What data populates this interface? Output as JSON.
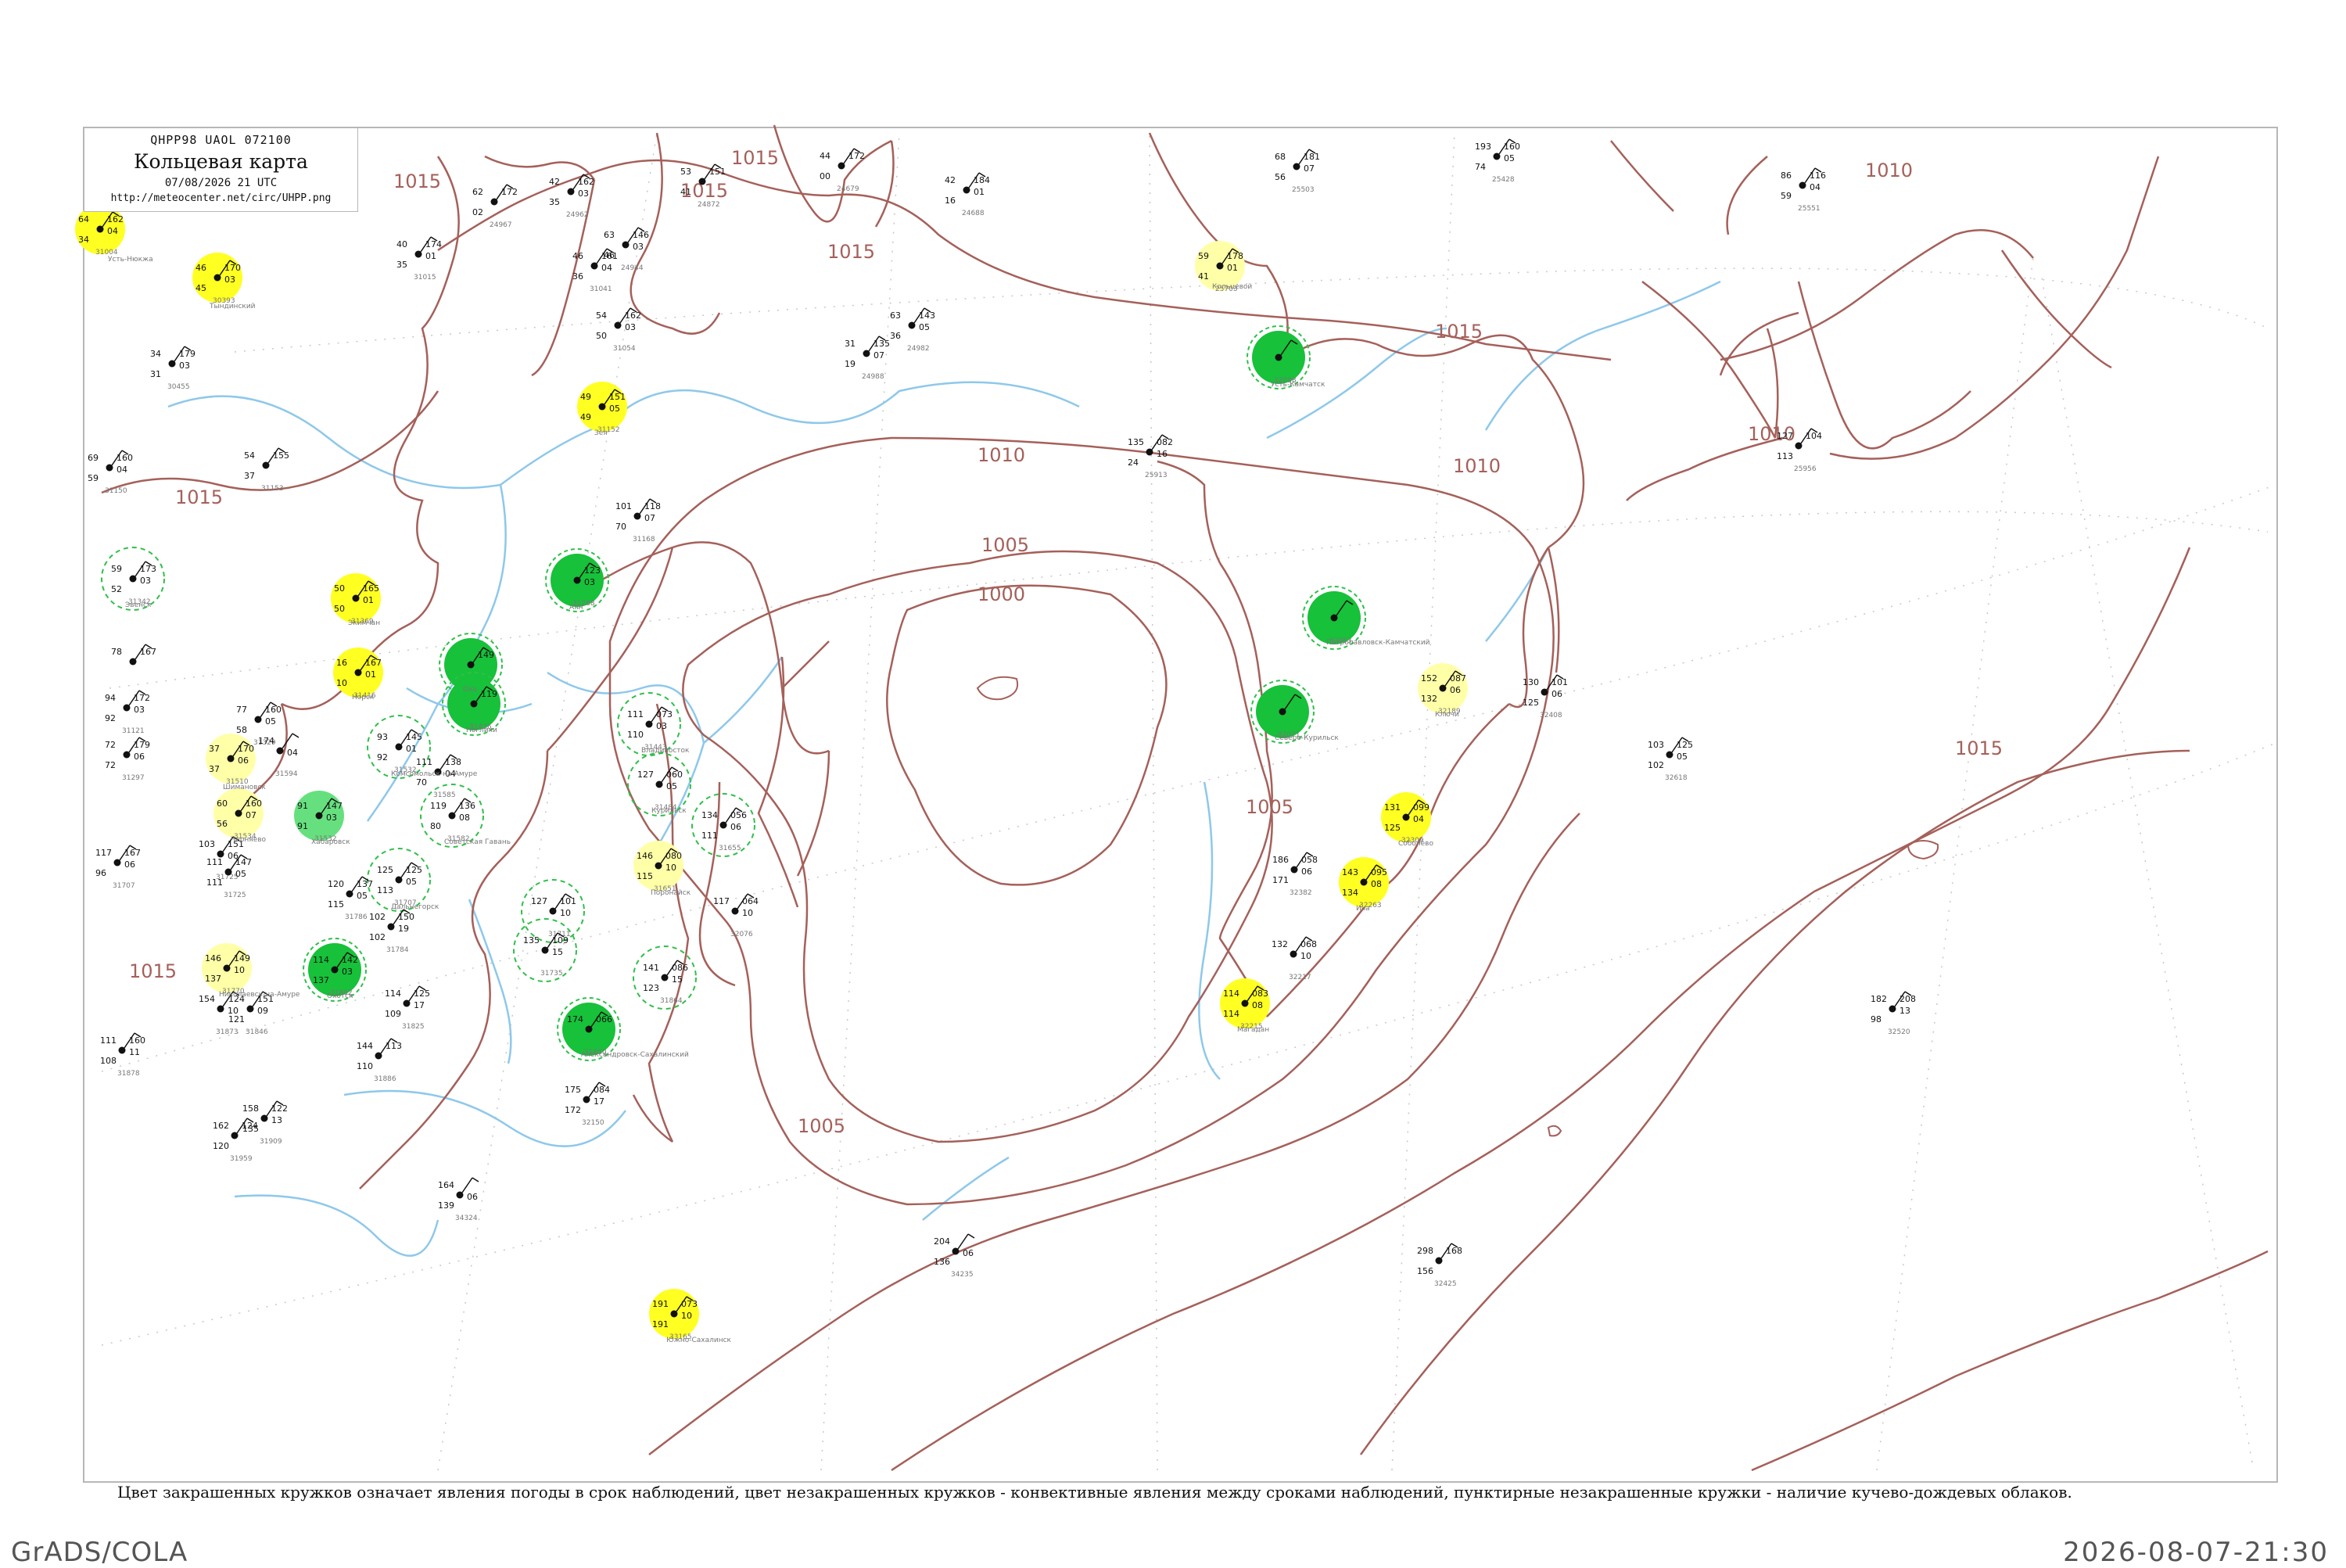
{
  "header": {
    "code_line": "QHPP98 UAOL 072100",
    "title": "Кольцевая карта",
    "date_line": "07/08/2026 21 UTC",
    "url": "http://meteocenter.net/circ/UHPP.png"
  },
  "caption": "Цвет закрашенных кружков означает явления погоды в срок наблюдений, цвет незакрашенных кружков - конвективные явления между сроками наблюдений, пунктирные незакрашенные кружки - наличие кучево-дождевых облаков.",
  "footer": {
    "left": "GrADS/COLA",
    "right": "2026-08-07-21:30"
  },
  "colors": {
    "coast": "#a5605a",
    "river": "#8ec8ea",
    "isobar": "#a5605a",
    "yellow": "#ffff22",
    "pale_yellow": "#ffffa8",
    "green": "#17c13a",
    "light_green": "#66e07e",
    "dashed_green": "#2fbf4a"
  },
  "isobar_labels": [
    {
      "text": "1015"
    },
    {
      "text": "1015"
    },
    {
      "text": "1015"
    },
    {
      "text": "1015"
    },
    {
      "text": "1015"
    },
    {
      "text": "1015"
    },
    {
      "text": "1015"
    },
    {
      "text": "1010"
    },
    {
      "text": "1010"
    },
    {
      "text": "1010"
    },
    {
      "text": "1010"
    },
    {
      "text": "1005"
    },
    {
      "text": "1005"
    },
    {
      "text": "1005"
    },
    {
      "text": "1000"
    },
    {
      "text": "1015"
    }
  ],
  "stations": [
    {
      "kind": "yellow",
      "t": "64",
      "td": "34",
      "p": "162",
      "dp": "04",
      "id": "31004"
    },
    {
      "kind": "yellow",
      "t": "46",
      "td": "45",
      "p": "170",
      "dp": "03",
      "id": "30393"
    },
    {
      "kind": "yellow",
      "t": "49",
      "td": "49",
      "p": "151",
      "dp": "05",
      "id": "31152"
    },
    {
      "kind": "pale_yellow",
      "t": "59",
      "td": "41",
      "p": "178",
      "dp": "01",
      "id": "25703"
    },
    {
      "kind": "yellow",
      "t": "50",
      "td": "50",
      "p": "165",
      "dp": "01",
      "id": "31369"
    },
    {
      "kind": "yellow",
      "t": "16",
      "td": "10",
      "p": "167",
      "dp": "01",
      "id": "31416"
    },
    {
      "kind": "pale_yellow",
      "t": "37",
      "td": "37",
      "p": "170",
      "dp": "06",
      "id": "31510"
    },
    {
      "kind": "pale_yellow",
      "t": "60",
      "td": "56",
      "p": "160",
      "dp": "07",
      "id": "31534"
    },
    {
      "kind": "light_green",
      "t": "91",
      "td": "91",
      "p": "147",
      "dp": "03",
      "id": "31532"
    },
    {
      "kind": "pale_yellow",
      "t": "146",
      "td": "137",
      "p": "149",
      "dp": "10",
      "id": "31770"
    },
    {
      "kind": "green",
      "t": "114",
      "td": "137",
      "p": "142",
      "dp": "03",
      "id": "31802"
    },
    {
      "kind": "green",
      "t": "",
      "td": "",
      "p": "123",
      "dp": "03",
      "id": "31288"
    },
    {
      "kind": "green",
      "t": "",
      "td": "",
      "p": "149",
      "dp": "",
      "id": "31418"
    },
    {
      "kind": "green",
      "t": "",
      "td": "",
      "p": "119",
      "dp": "",
      "id": "31436"
    },
    {
      "kind": "green",
      "t": "174",
      "td": "",
      "p": "066",
      "dp": "",
      "id": "31850"
    },
    {
      "kind": "pale_yellow",
      "t": "146",
      "td": "115",
      "p": "080",
      "dp": "10",
      "id": "31651"
    },
    {
      "kind": "yellow",
      "t": "191",
      "td": "191",
      "p": "073",
      "dp": "10",
      "id": "33165"
    },
    {
      "kind": "green",
      "t": "",
      "td": "",
      "p": "",
      "dp": "",
      "id": "32053"
    },
    {
      "kind": "green",
      "t": "",
      "td": "",
      "p": "",
      "dp": "",
      "id": "32071"
    },
    {
      "kind": "green",
      "t": "",
      "td": "",
      "p": "",
      "dp": "",
      "id": "32098"
    },
    {
      "kind": "pale_yellow",
      "t": "152",
      "td": "132",
      "p": "087",
      "dp": "06",
      "id": "32189"
    },
    {
      "kind": "yellow",
      "t": "131",
      "td": "125",
      "p": "099",
      "dp": "04",
      "id": "32309"
    },
    {
      "kind": "yellow",
      "t": "143",
      "td": "134",
      "p": "095",
      "dp": "08",
      "id": "32263"
    },
    {
      "kind": "yellow",
      "t": "114",
      "td": "114",
      "p": "083",
      "dp": "08",
      "id": "32215"
    },
    {
      "kind": "dashed",
      "t": "59",
      "td": "52",
      "p": "173",
      "dp": "03",
      "id": "31342"
    },
    {
      "kind": "dashed",
      "t": "93",
      "td": "92",
      "p": "145",
      "dp": "01",
      "id": "31532"
    },
    {
      "kind": "dashed",
      "t": "119",
      "td": "80",
      "p": "136",
      "dp": "08",
      "id": "31582"
    },
    {
      "kind": "dashed",
      "t": "125",
      "td": "113",
      "p": "125",
      "dp": "05",
      "id": "31707"
    },
    {
      "kind": "dashed",
      "t": "111",
      "td": "110",
      "p": "073",
      "dp": "03",
      "id": "31443"
    },
    {
      "kind": "dashed",
      "t": "127",
      "td": "",
      "p": "060",
      "dp": "05",
      "id": "31484"
    },
    {
      "kind": "dashed",
      "t": "134",
      "td": "111",
      "p": "056",
      "dp": "06",
      "id": "31655"
    },
    {
      "kind": "dashed",
      "t": "127",
      "td": "",
      "p": "101",
      "dp": "10",
      "id": "31711"
    },
    {
      "kind": "dashed",
      "t": "135",
      "td": "",
      "p": "109",
      "dp": "15",
      "id": "31735"
    },
    {
      "kind": "dashed",
      "t": "141",
      "td": "123",
      "p": "086",
      "dp": "15",
      "id": "31864"
    },
    {
      "kind": "plain",
      "t": "53",
      "td": "41",
      "p": "151",
      "dp": "",
      "id": "24872"
    },
    {
      "kind": "plain",
      "t": "44",
      "td": "00",
      "p": "172",
      "dp": "",
      "id": "24679"
    },
    {
      "kind": "plain",
      "t": "42",
      "td": "16",
      "p": "184",
      "dp": "01",
      "id": "24688"
    },
    {
      "kind": "plain",
      "t": "68",
      "td": "56",
      "p": "181",
      "dp": "07",
      "id": "25503"
    },
    {
      "kind": "plain",
      "t": "193",
      "td": "74",
      "p": "160",
      "dp": "05",
      "id": "25428"
    },
    {
      "kind": "plain",
      "t": "86",
      "td": "59",
      "p": "116",
      "dp": "04",
      "id": "25551"
    },
    {
      "kind": "plain",
      "t": "62",
      "td": "02",
      "p": "172",
      "dp": "",
      "id": "24967"
    },
    {
      "kind": "plain",
      "t": "42",
      "td": "35",
      "p": "162",
      "dp": "03",
      "id": "24962"
    },
    {
      "kind": "plain",
      "t": "63",
      "td": "46",
      "p": "146",
      "dp": "03",
      "id": "24944"
    },
    {
      "kind": "plain",
      "t": "46",
      "td": "36",
      "p": "161",
      "dp": "04",
      "id": "31041"
    },
    {
      "kind": "plain",
      "t": "54",
      "td": "50",
      "p": "162",
      "dp": "03",
      "id": "31054"
    },
    {
      "kind": "plain",
      "t": "31",
      "td": "19",
      "p": "135",
      "dp": "07",
      "id": "24988"
    },
    {
      "kind": "plain",
      "t": "63",
      "td": "36",
      "p": "143",
      "dp": "05",
      "id": "24982"
    },
    {
      "kind": "plain",
      "t": "135",
      "td": "24",
      "p": "082",
      "dp": "16",
      "id": "25913"
    },
    {
      "kind": "plain",
      "t": "127",
      "td": "113",
      "p": "104",
      "dp": "",
      "id": "25956"
    },
    {
      "kind": "plain",
      "t": "101",
      "td": "70",
      "p": "118",
      "dp": "07",
      "id": "31168"
    },
    {
      "kind": "plain",
      "t": "130",
      "td": "125",
      "p": "101",
      "dp": "06",
      "id": "32408"
    },
    {
      "kind": "plain",
      "t": "103",
      "td": "102",
      "p": "125",
      "dp": "05",
      "id": "32618"
    },
    {
      "kind": "plain",
      "t": "186",
      "td": "171",
      "p": "058",
      "dp": "06",
      "id": "32382"
    },
    {
      "kind": "plain",
      "t": "132",
      "td": "",
      "p": "068",
      "dp": "10",
      "id": "32217"
    },
    {
      "kind": "plain",
      "t": "182",
      "td": "98",
      "p": "208",
      "dp": "13",
      "id": "32520"
    },
    {
      "kind": "plain",
      "t": "298",
      "td": "156",
      "p": "168",
      "dp": "",
      "id": "32425"
    },
    {
      "kind": "plain",
      "t": "204",
      "td": "136",
      "p": "",
      "dp": "06",
      "id": "34235"
    },
    {
      "kind": "plain",
      "t": "175",
      "td": "172",
      "p": "084",
      "dp": "17",
      "id": "32150"
    },
    {
      "kind": "plain",
      "t": "117",
      "td": "",
      "p": "064",
      "dp": "10",
      "id": "32076"
    },
    {
      "kind": "plain",
      "t": "34",
      "td": "31",
      "p": "179",
      "dp": "03",
      "id": "30455"
    },
    {
      "kind": "plain",
      "t": "69",
      "td": "59",
      "p": "160",
      "dp": "04",
      "id": "31150"
    },
    {
      "kind": "plain",
      "t": "54",
      "td": "37",
      "p": "155",
      "dp": "",
      "id": "31153"
    },
    {
      "kind": "plain",
      "t": "40",
      "td": "35",
      "p": "174",
      "dp": "01",
      "id": "31015"
    },
    {
      "kind": "plain",
      "t": "78",
      "td": "",
      "p": "167",
      "dp": "",
      "id": ""
    },
    {
      "kind": "plain",
      "t": "94",
      "td": "92",
      "p": "172",
      "dp": "03",
      "id": "31121"
    },
    {
      "kind": "plain",
      "t": "72",
      "td": "72",
      "p": "179",
      "dp": "06",
      "id": "31297"
    },
    {
      "kind": "plain",
      "t": "77",
      "td": "58",
      "p": "160",
      "dp": "05",
      "id": "31329"
    },
    {
      "kind": "plain",
      "t": "174",
      "td": "",
      "p": "",
      "dp": "04",
      "id": "31594"
    },
    {
      "kind": "plain",
      "t": "117",
      "td": "96",
      "p": "167",
      "dp": "06",
      "id": "31707"
    },
    {
      "kind": "plain",
      "t": "103",
      "td": "",
      "p": "151",
      "dp": "06",
      "id": "31725"
    },
    {
      "kind": "plain",
      "t": "111",
      "td": "111",
      "p": "147",
      "dp": "05",
      "id": "31725"
    },
    {
      "kind": "plain",
      "t": "120",
      "td": "115",
      "p": "137",
      "dp": "05",
      "id": "31786"
    },
    {
      "kind": "plain",
      "t": "102",
      "td": "102",
      "p": "150",
      "dp": "19",
      "id": "31784"
    },
    {
      "kind": "plain",
      "t": "111",
      "td": "70",
      "p": "138",
      "dp": "04",
      "id": "31585"
    },
    {
      "kind": "plain",
      "t": "114",
      "td": "109",
      "p": "125",
      "dp": "17",
      "id": "31825"
    },
    {
      "kind": "plain",
      "t": "124",
      "td": "121",
      "p": "151",
      "dp": "09",
      "id": "31846"
    },
    {
      "kind": "plain",
      "t": "154",
      "td": "",
      "p": "",
      "dp": "10",
      "id": "31873"
    },
    {
      "kind": "plain",
      "t": "111",
      "td": "108",
      "p": "160",
      "dp": "11",
      "id": "31878"
    },
    {
      "kind": "plain",
      "t": "144",
      "td": "110",
      "p": "113",
      "dp": "",
      "id": "31886"
    },
    {
      "kind": "plain",
      "t": "158",
      "td": "135",
      "p": "122",
      "dp": "13",
      "id": "31909"
    },
    {
      "kind": "plain",
      "t": "162",
      "td": "120",
      "p": "124",
      "dp": "",
      "id": "31959"
    },
    {
      "kind": "plain",
      "t": "164",
      "td": "139",
      "p": "",
      "dp": "06",
      "id": "34324"
    }
  ],
  "place_names": [
    "Усть-Нюкжа",
    "Тындинский",
    "Зея",
    "Кольцевой",
    "Экимчан",
    "Норск",
    "Шимановск",
    "Черняево",
    "Хабаровск",
    "Николаевск-на-Амуре",
    "Охотск",
    "Аян",
    "Оха",
    "Ноглики",
    "Александровск-Сахалинский",
    "Поронайск",
    "Южно-Сахалинск",
    "Петропавловск-Камчатский",
    "Северо-Курильск",
    "Усть-Камчатск",
    "Ключи",
    "Соболево",
    "Ича",
    "Магадан",
    "Эвенск",
    "Комсомольск-на-Амуре",
    "Советская Гавань",
    "Дальнегорск",
    "Владивосток",
    "Курильск"
  ]
}
